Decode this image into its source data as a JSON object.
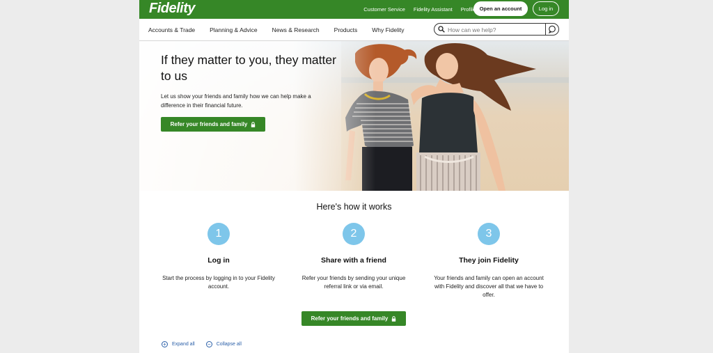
{
  "header": {
    "logo": "Fidelity",
    "links": [
      "Customer Service",
      "Fidelity Assistant",
      "Profile"
    ],
    "open_account": "Open an account",
    "login": "Log in"
  },
  "nav": {
    "items": [
      "Accounts & Trade",
      "Planning & Advice",
      "News & Research",
      "Products",
      "Why Fidelity"
    ],
    "search_placeholder": "How can we help?"
  },
  "hero": {
    "title": "If they matter to you, they matter to us",
    "body": "Let us show your friends and family how we can help make a difference in their financial future.",
    "cta": "Refer your friends and family"
  },
  "how": {
    "title": "Here's how it works",
    "steps": [
      {
        "num": "1",
        "title": "Log in",
        "text": "Start the process by logging in to your Fidelity account."
      },
      {
        "num": "2",
        "title": "Share with a friend",
        "text": "Refer your friends by sending your unique referral link or via email."
      },
      {
        "num": "3",
        "title": "They join Fidelity",
        "text": "Your friends and family can open an account with Fidelity and discover all that we have to offer."
      }
    ],
    "cta": "Refer your friends and family"
  },
  "faq": {
    "expand": "Expand all",
    "collapse": "Collapse all"
  },
  "colors": {
    "brand_green": "#368727",
    "step_blue": "#7ec6ea",
    "link_blue": "#2a5fa8"
  }
}
